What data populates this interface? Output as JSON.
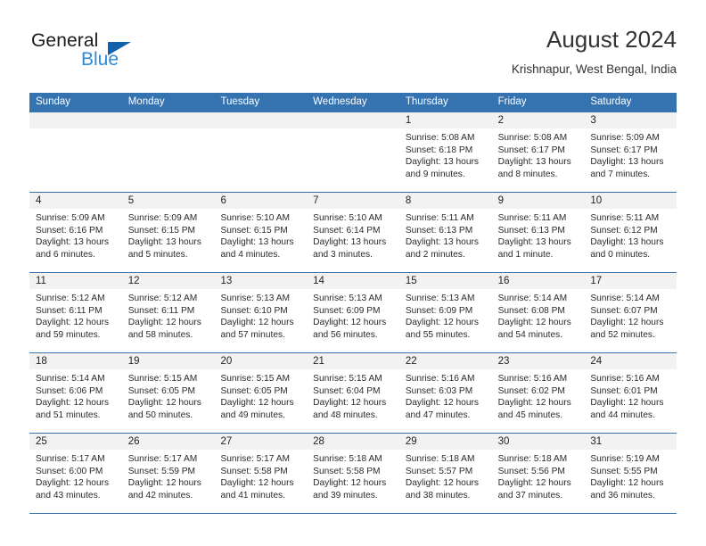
{
  "brand": {
    "name_top": "General",
    "name_bottom": "Blue",
    "triangle_color": "#1161ad",
    "blue_color": "#2e8bd8"
  },
  "header": {
    "title": "August 2024",
    "subtitle": "Krishnapur, West Bengal, India"
  },
  "theme": {
    "header_bar_color": "#3572b0",
    "day_band_color": "#f2f2f2"
  },
  "weekdays": [
    "Sunday",
    "Monday",
    "Tuesday",
    "Wednesday",
    "Thursday",
    "Friday",
    "Saturday"
  ],
  "labels": {
    "sunrise_prefix": "Sunrise:",
    "sunset_prefix": "Sunset:",
    "daylight_prefix": "Daylight:"
  },
  "weeks": [
    [
      {
        "day": "",
        "empty": true
      },
      {
        "day": "",
        "empty": true
      },
      {
        "day": "",
        "empty": true
      },
      {
        "day": "",
        "empty": true
      },
      {
        "day": "1",
        "line1": "Sunrise: 5:08 AM",
        "line2": "Sunset: 6:18 PM",
        "line3": "Daylight: 13 hours",
        "line4": "and 9 minutes."
      },
      {
        "day": "2",
        "line1": "Sunrise: 5:08 AM",
        "line2": "Sunset: 6:17 PM",
        "line3": "Daylight: 13 hours",
        "line4": "and 8 minutes."
      },
      {
        "day": "3",
        "line1": "Sunrise: 5:09 AM",
        "line2": "Sunset: 6:17 PM",
        "line3": "Daylight: 13 hours",
        "line4": "and 7 minutes."
      }
    ],
    [
      {
        "day": "4",
        "line1": "Sunrise: 5:09 AM",
        "line2": "Sunset: 6:16 PM",
        "line3": "Daylight: 13 hours",
        "line4": "and 6 minutes."
      },
      {
        "day": "5",
        "line1": "Sunrise: 5:09 AM",
        "line2": "Sunset: 6:15 PM",
        "line3": "Daylight: 13 hours",
        "line4": "and 5 minutes."
      },
      {
        "day": "6",
        "line1": "Sunrise: 5:10 AM",
        "line2": "Sunset: 6:15 PM",
        "line3": "Daylight: 13 hours",
        "line4": "and 4 minutes."
      },
      {
        "day": "7",
        "line1": "Sunrise: 5:10 AM",
        "line2": "Sunset: 6:14 PM",
        "line3": "Daylight: 13 hours",
        "line4": "and 3 minutes."
      },
      {
        "day": "8",
        "line1": "Sunrise: 5:11 AM",
        "line2": "Sunset: 6:13 PM",
        "line3": "Daylight: 13 hours",
        "line4": "and 2 minutes."
      },
      {
        "day": "9",
        "line1": "Sunrise: 5:11 AM",
        "line2": "Sunset: 6:13 PM",
        "line3": "Daylight: 13 hours",
        "line4": "and 1 minute."
      },
      {
        "day": "10",
        "line1": "Sunrise: 5:11 AM",
        "line2": "Sunset: 6:12 PM",
        "line3": "Daylight: 13 hours",
        "line4": "and 0 minutes."
      }
    ],
    [
      {
        "day": "11",
        "line1": "Sunrise: 5:12 AM",
        "line2": "Sunset: 6:11 PM",
        "line3": "Daylight: 12 hours",
        "line4": "and 59 minutes."
      },
      {
        "day": "12",
        "line1": "Sunrise: 5:12 AM",
        "line2": "Sunset: 6:11 PM",
        "line3": "Daylight: 12 hours",
        "line4": "and 58 minutes."
      },
      {
        "day": "13",
        "line1": "Sunrise: 5:13 AM",
        "line2": "Sunset: 6:10 PM",
        "line3": "Daylight: 12 hours",
        "line4": "and 57 minutes."
      },
      {
        "day": "14",
        "line1": "Sunrise: 5:13 AM",
        "line2": "Sunset: 6:09 PM",
        "line3": "Daylight: 12 hours",
        "line4": "and 56 minutes."
      },
      {
        "day": "15",
        "line1": "Sunrise: 5:13 AM",
        "line2": "Sunset: 6:09 PM",
        "line3": "Daylight: 12 hours",
        "line4": "and 55 minutes."
      },
      {
        "day": "16",
        "line1": "Sunrise: 5:14 AM",
        "line2": "Sunset: 6:08 PM",
        "line3": "Daylight: 12 hours",
        "line4": "and 54 minutes."
      },
      {
        "day": "17",
        "line1": "Sunrise: 5:14 AM",
        "line2": "Sunset: 6:07 PM",
        "line3": "Daylight: 12 hours",
        "line4": "and 52 minutes."
      }
    ],
    [
      {
        "day": "18",
        "line1": "Sunrise: 5:14 AM",
        "line2": "Sunset: 6:06 PM",
        "line3": "Daylight: 12 hours",
        "line4": "and 51 minutes."
      },
      {
        "day": "19",
        "line1": "Sunrise: 5:15 AM",
        "line2": "Sunset: 6:05 PM",
        "line3": "Daylight: 12 hours",
        "line4": "and 50 minutes."
      },
      {
        "day": "20",
        "line1": "Sunrise: 5:15 AM",
        "line2": "Sunset: 6:05 PM",
        "line3": "Daylight: 12 hours",
        "line4": "and 49 minutes."
      },
      {
        "day": "21",
        "line1": "Sunrise: 5:15 AM",
        "line2": "Sunset: 6:04 PM",
        "line3": "Daylight: 12 hours",
        "line4": "and 48 minutes."
      },
      {
        "day": "22",
        "line1": "Sunrise: 5:16 AM",
        "line2": "Sunset: 6:03 PM",
        "line3": "Daylight: 12 hours",
        "line4": "and 47 minutes."
      },
      {
        "day": "23",
        "line1": "Sunrise: 5:16 AM",
        "line2": "Sunset: 6:02 PM",
        "line3": "Daylight: 12 hours",
        "line4": "and 45 minutes."
      },
      {
        "day": "24",
        "line1": "Sunrise: 5:16 AM",
        "line2": "Sunset: 6:01 PM",
        "line3": "Daylight: 12 hours",
        "line4": "and 44 minutes."
      }
    ],
    [
      {
        "day": "25",
        "line1": "Sunrise: 5:17 AM",
        "line2": "Sunset: 6:00 PM",
        "line3": "Daylight: 12 hours",
        "line4": "and 43 minutes."
      },
      {
        "day": "26",
        "line1": "Sunrise: 5:17 AM",
        "line2": "Sunset: 5:59 PM",
        "line3": "Daylight: 12 hours",
        "line4": "and 42 minutes."
      },
      {
        "day": "27",
        "line1": "Sunrise: 5:17 AM",
        "line2": "Sunset: 5:58 PM",
        "line3": "Daylight: 12 hours",
        "line4": "and 41 minutes."
      },
      {
        "day": "28",
        "line1": "Sunrise: 5:18 AM",
        "line2": "Sunset: 5:58 PM",
        "line3": "Daylight: 12 hours",
        "line4": "and 39 minutes."
      },
      {
        "day": "29",
        "line1": "Sunrise: 5:18 AM",
        "line2": "Sunset: 5:57 PM",
        "line3": "Daylight: 12 hours",
        "line4": "and 38 minutes."
      },
      {
        "day": "30",
        "line1": "Sunrise: 5:18 AM",
        "line2": "Sunset: 5:56 PM",
        "line3": "Daylight: 12 hours",
        "line4": "and 37 minutes."
      },
      {
        "day": "31",
        "line1": "Sunrise: 5:19 AM",
        "line2": "Sunset: 5:55 PM",
        "line3": "Daylight: 12 hours",
        "line4": "and 36 minutes."
      }
    ]
  ]
}
